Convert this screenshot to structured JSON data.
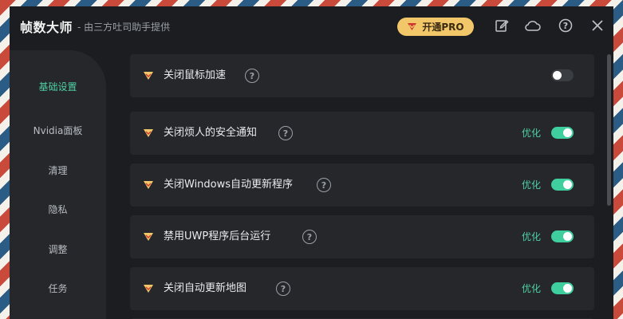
{
  "app": {
    "title": "帧数大师",
    "subtitle": "- 由三方吐司助手提供",
    "pro_label": "开通PRO"
  },
  "toolbar_icons": [
    "edit-icon",
    "cloud-icon",
    "help-icon",
    "close-icon"
  ],
  "sidebar": {
    "items": [
      {
        "label": "基础设置",
        "active": true
      },
      {
        "label": "Nvidia面板",
        "active": false
      },
      {
        "label": "清理",
        "active": false
      },
      {
        "label": "隐私",
        "active": false
      },
      {
        "label": "调整",
        "active": false
      },
      {
        "label": "任务",
        "active": false
      }
    ]
  },
  "settings": {
    "rows": [
      {
        "label": "关闭鼠标加速",
        "status": "",
        "enabled": false
      },
      {
        "label": "关闭烦人的安全通知",
        "status": "优化",
        "enabled": true
      },
      {
        "label": "关闭Windows自动更新程序",
        "status": "优化",
        "enabled": true
      },
      {
        "label": "禁用UWP程序后台运行",
        "status": "优化",
        "enabled": true
      },
      {
        "label": "关闭自动更新地图",
        "status": "优化",
        "enabled": true
      }
    ]
  },
  "colors": {
    "accent": "#4fd1a5",
    "pro_button": "#f1c76a",
    "background": "#1b1d20",
    "panel": "#25272b"
  }
}
